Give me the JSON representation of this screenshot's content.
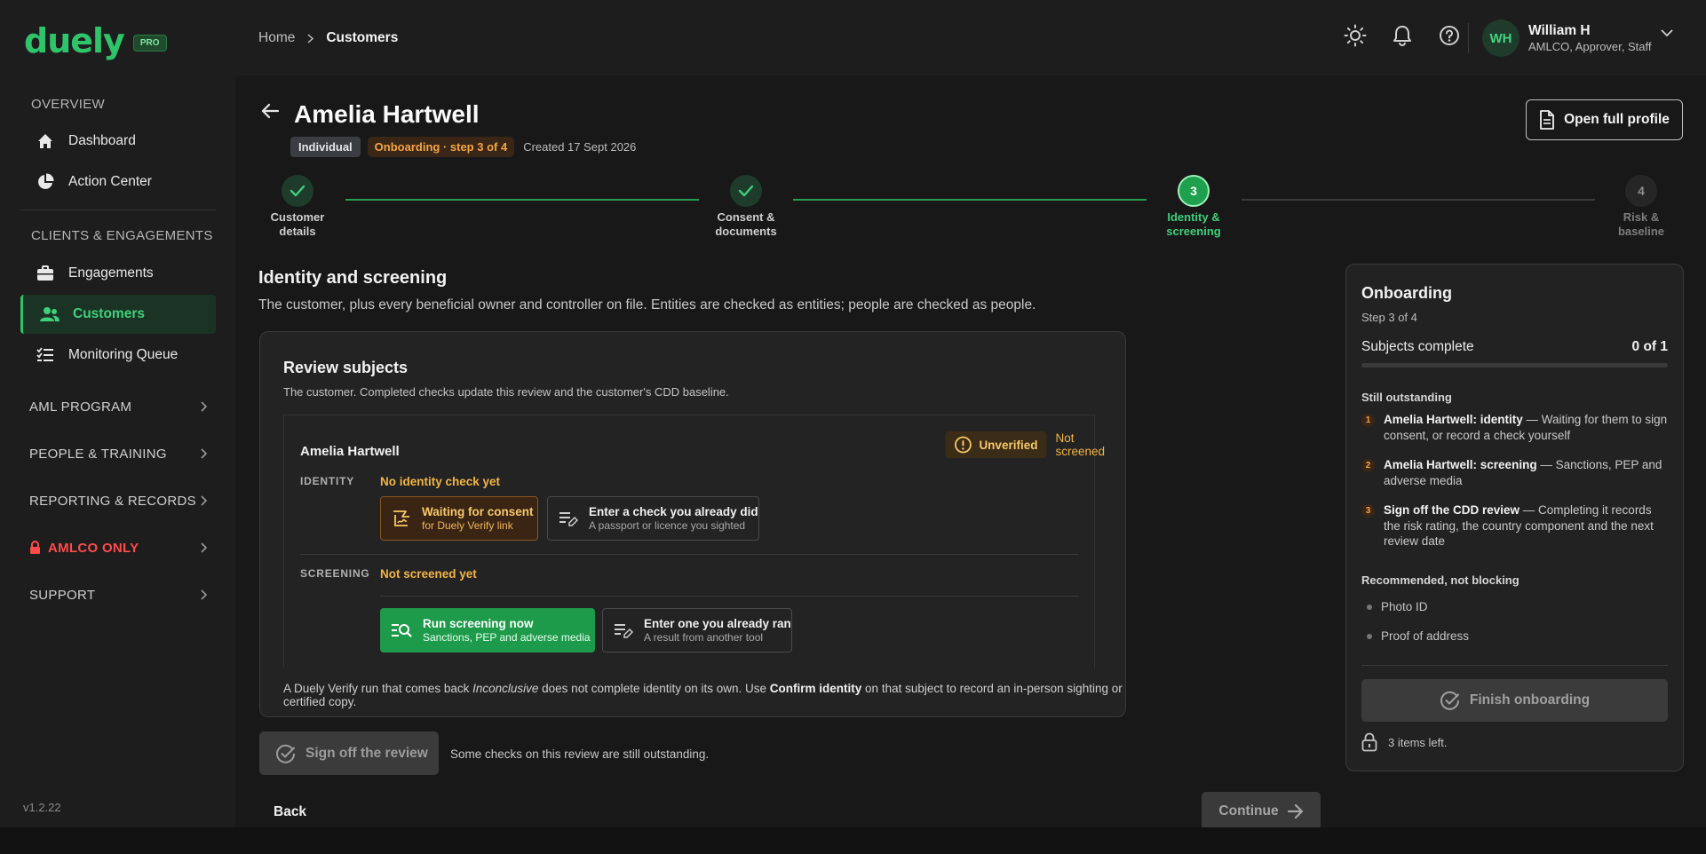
{
  "brand": {
    "logo": "duely",
    "badge": "PRO"
  },
  "sidebar": {
    "overview_label": "OVERVIEW",
    "dashboard": "Dashboard",
    "action_center": "Action Center",
    "clients_label": "CLIENTS & ENGAGEMENTS",
    "engagements": "Engagements",
    "customers": "Customers",
    "monitoring_queue": "Monitoring Queue",
    "groups": {
      "aml_program": "AML PROGRAM",
      "people_training": "PEOPLE & TRAINING",
      "reporting_records": "REPORTING & RECORDS",
      "amlco_only": "AMLCO ONLY",
      "support": "SUPPORT"
    },
    "version": "v1.2.22"
  },
  "topbar": {
    "breadcrumb_home": "Home",
    "breadcrumb_current": "Customers",
    "user_initials": "WH",
    "user_name": "William H",
    "user_role": "AMLCO, Approver, Staff"
  },
  "header": {
    "title": "Amelia Hartwell",
    "type_badge": "Individual",
    "step_badge": "Onboarding · step 3 of 4",
    "created": "Created 17 Sept 2026",
    "open_profile": "Open full profile"
  },
  "stepper": {
    "steps": [
      {
        "line1": "Customer",
        "line2": "details",
        "state": "done"
      },
      {
        "line1": "Consent &",
        "line2": "documents",
        "state": "done"
      },
      {
        "line1": "Identity &",
        "line2": "screening",
        "state": "current",
        "num": "3"
      },
      {
        "line1": "Risk &",
        "line2": "baseline",
        "state": "todo",
        "num": "4"
      }
    ]
  },
  "section": {
    "title": "Identity and screening",
    "subtitle": "The customer, plus every beneficial owner and controller on file. Entities are checked as entities; people are checked as people."
  },
  "review": {
    "title": "Review subjects",
    "subtitle": "The customer. Completed checks update this review and the customer's CDD baseline.",
    "subject_name": "Amelia Hartwell",
    "verification_badge": "Unverified",
    "screening_badge": "Not screened",
    "identity_label": "IDENTITY",
    "identity_status": "No identity check yet",
    "waiting_title": "Waiting for consent",
    "waiting_sub": "for Duely Verify link",
    "enter_check_title": "Enter a check you already did",
    "enter_check_sub": "A passport or licence you sighted",
    "screening_label": "SCREENING",
    "screening_status": "Not screened yet",
    "run_title": "Run screening now",
    "run_sub": "Sanctions, PEP and adverse media",
    "enter_run_title": "Enter one you already ran",
    "enter_run_sub": "A result from another tool",
    "note_pre": "A Duely Verify run that comes back ",
    "note_em": "Inconclusive",
    "note_mid": " does not complete identity on its own. Use ",
    "note_strong": "Confirm identity",
    "note_post": " on that subject to record an in-person sighting or certified copy."
  },
  "footer": {
    "signoff": "Sign off the review",
    "signoff_note": "Some checks on this review are still outstanding.",
    "back": "Back",
    "continue": "Continue"
  },
  "panel": {
    "title": "Onboarding",
    "step": "Step 3 of 4",
    "subjects_label": "Subjects complete",
    "subjects_value": "0 of 1",
    "progress": 0,
    "outstanding_label": "Still outstanding",
    "outstanding": [
      {
        "num": "1",
        "bold": "Amelia Hartwell: identity",
        "rest": " — Waiting for them to sign consent, or record a check yourself"
      },
      {
        "num": "2",
        "bold": "Amelia Hartwell: screening",
        "rest": " — Sanctions, PEP and adverse media"
      },
      {
        "num": "3",
        "bold": "Sign off the CDD review",
        "rest": " — Completing it records the risk rating, the country component and the next review date"
      }
    ],
    "recommended_label": "Recommended, not blocking",
    "recommended": [
      "Photo ID",
      "Proof of address"
    ],
    "finish": "Finish onboarding",
    "items_left": "3 items left."
  },
  "colors": {
    "accent": "#2fc36a",
    "warning": "#f2b545",
    "danger": "#ff4b4b"
  }
}
